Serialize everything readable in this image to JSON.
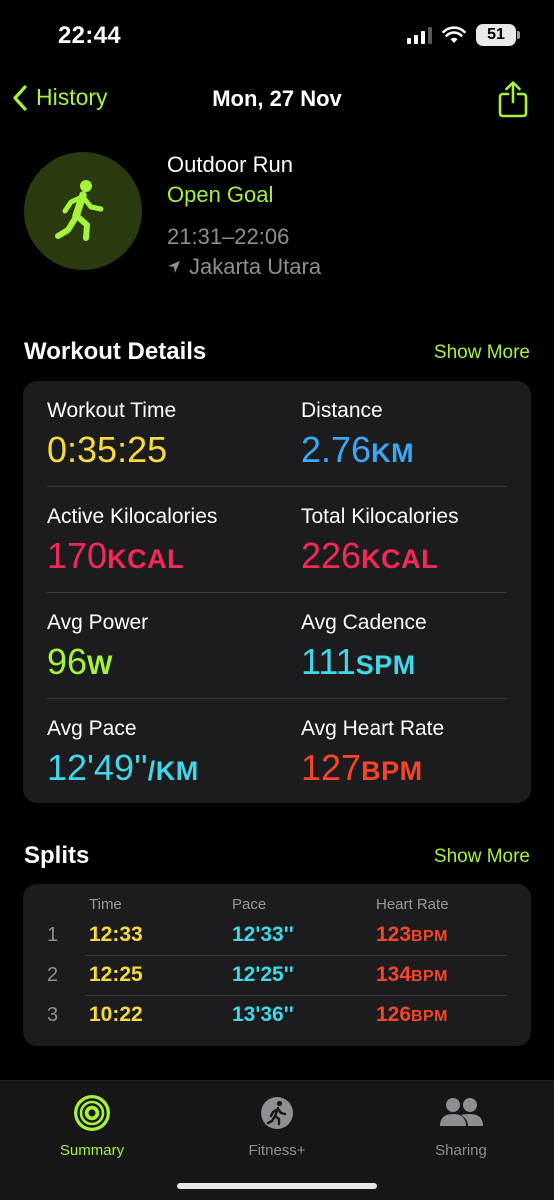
{
  "status_bar": {
    "time": "22:44",
    "battery": "51"
  },
  "nav": {
    "back_label": "History",
    "title": "Mon, 27 Nov"
  },
  "workout": {
    "title": "Outdoor Run",
    "goal": "Open Goal",
    "time_range": "21:31–22:06",
    "location": "Jakarta Utara"
  },
  "details": {
    "title": "Workout Details",
    "show_more": "Show More",
    "metrics": [
      {
        "label": "Workout Time",
        "value": "0:35:25",
        "unit": "",
        "color": "#f5dc3c"
      },
      {
        "label": "Distance",
        "value": "2.76",
        "unit": "KM",
        "color": "#3aa8f5"
      },
      {
        "label": "Active Kilocalories",
        "value": "170",
        "unit": "KCAL",
        "color": "#f5285a"
      },
      {
        "label": "Total Kilocalories",
        "value": "226",
        "unit": "KCAL",
        "color": "#f5285a"
      },
      {
        "label": "Avg Power",
        "value": "96",
        "unit": "W",
        "color": "#a6f33a"
      },
      {
        "label": "Avg Cadence",
        "value": "111",
        "unit": "SPM",
        "color": "#40d8e8"
      },
      {
        "label": "Avg Pace",
        "value": "12'49''",
        "unit": "/KM",
        "color": "#40d8e8"
      },
      {
        "label": "Avg Heart Rate",
        "value": "127",
        "unit": "BPM",
        "color": "#f5452a"
      }
    ]
  },
  "splits": {
    "title": "Splits",
    "show_more": "Show More",
    "columns": [
      "Time",
      "Pace",
      "Heart Rate"
    ],
    "rows": [
      {
        "index": "1",
        "time": "12:33",
        "pace": "12'33''",
        "hr": "123",
        "hr_unit": "BPM"
      },
      {
        "index": "2",
        "time": "12:25",
        "pace": "12'25''",
        "hr": "134",
        "hr_unit": "BPM"
      },
      {
        "index": "3",
        "time": "10:22",
        "pace": "13'36''",
        "hr": "126",
        "hr_unit": "BPM"
      }
    ]
  },
  "tabs": [
    {
      "label": "Summary",
      "icon": "activity-rings-icon",
      "active": true
    },
    {
      "label": "Fitness+",
      "icon": "fitness-plus-icon",
      "active": false
    },
    {
      "label": "Sharing",
      "icon": "sharing-icon",
      "active": false
    }
  ],
  "colors": {
    "accent": "#a6f33a",
    "time": "#f5dc3c",
    "pace": "#40d8e8",
    "heart_rate": "#f5452a",
    "inactive_tab": "#8e8e93"
  }
}
